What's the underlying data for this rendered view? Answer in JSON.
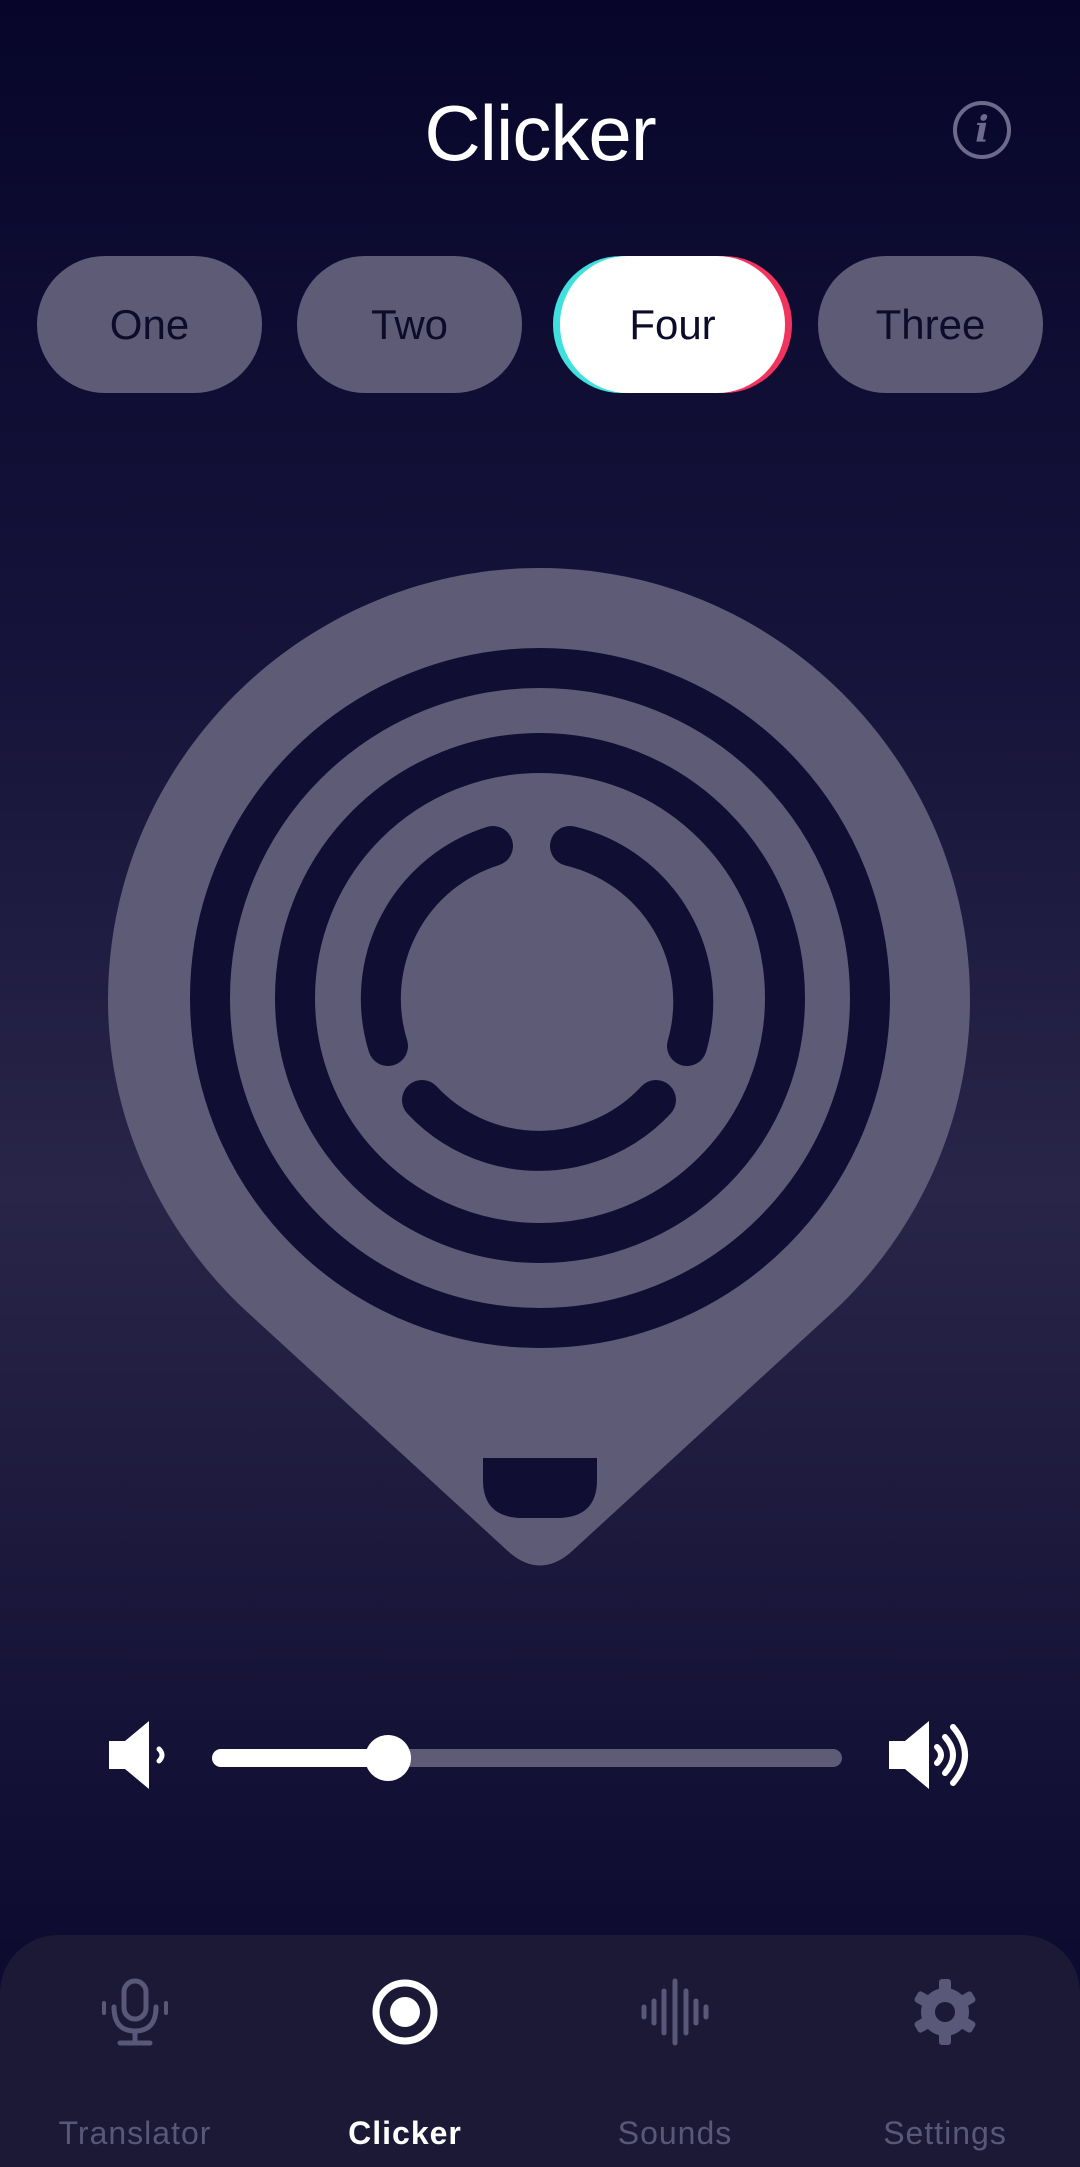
{
  "header": {
    "title": "Clicker",
    "info_icon": "info-icon"
  },
  "chips": [
    {
      "label": "One",
      "active": false
    },
    {
      "label": "Two",
      "active": false
    },
    {
      "label": "Four",
      "active": true
    },
    {
      "label": "Three",
      "active": false
    }
  ],
  "clicker": {
    "icon": "clicker-device-icon"
  },
  "volume": {
    "level_fraction": 0.28,
    "mute_icon": "volume-low-icon",
    "max_icon": "volume-high-icon"
  },
  "nav": {
    "items": [
      {
        "label": "Translator",
        "icon": "microphone-icon",
        "active": false
      },
      {
        "label": "Clicker",
        "icon": "clicker-icon",
        "active": true
      },
      {
        "label": "Sounds",
        "icon": "sound-wave-icon",
        "active": false
      },
      {
        "label": "Settings",
        "icon": "gear-icon",
        "active": false
      }
    ]
  },
  "colors": {
    "background": "#0b0a2d",
    "chip": "#5d5b76",
    "chip_active": "#ffffff",
    "accent_cyan": "#3fe0dd",
    "accent_red": "#f0345d",
    "inactive_text": "#5a5878"
  }
}
